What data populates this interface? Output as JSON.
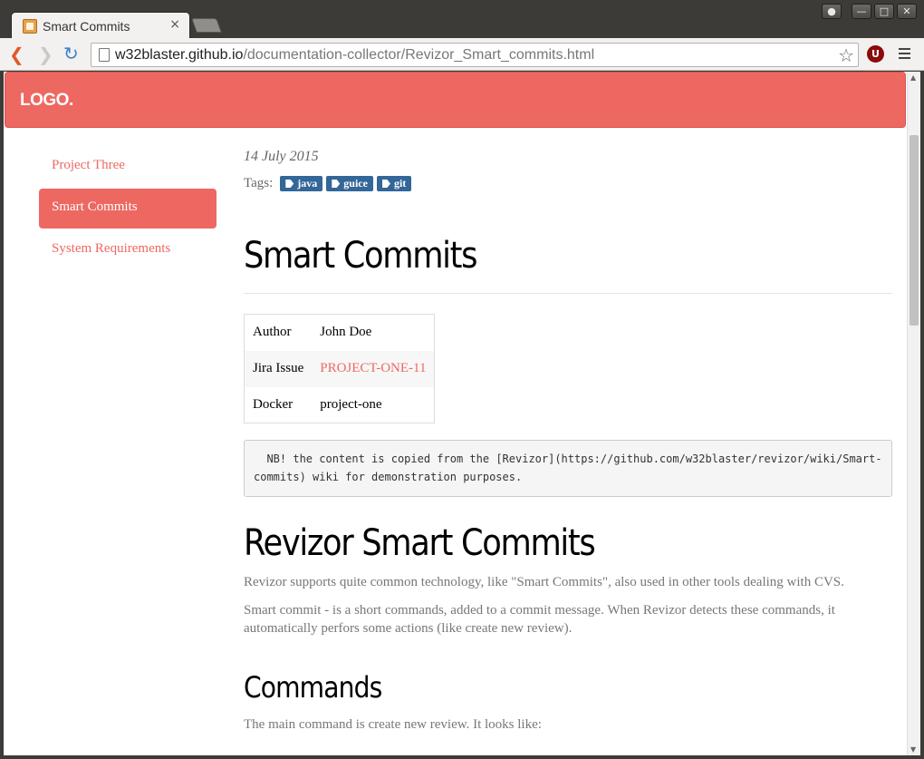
{
  "browser": {
    "tab_title": "Smart Commits",
    "tab_close": "×",
    "url_host": "w32blaster.github.io",
    "url_path": "/documentation-collector/Revizor_Smart_commits.html",
    "extension_label": "U"
  },
  "header": {
    "logo": "LOGO."
  },
  "sidebar": {
    "items": [
      {
        "label": "Project Three"
      },
      {
        "label": "Smart Commits"
      },
      {
        "label": "System Requirements"
      }
    ]
  },
  "article": {
    "date": "14 July 2015",
    "tags_label": "Tags:",
    "tags": [
      "java",
      "guice",
      "git"
    ],
    "title": "Smart Commits",
    "meta": [
      {
        "key": "Author",
        "value": "John Doe"
      },
      {
        "key": "Jira Issue",
        "value": "PROJECT-ONE-11"
      },
      {
        "key": "Docker",
        "value": "project-one"
      }
    ],
    "note": "  NB! the content is copied from the [Revizor](https://github.com/w32blaster/revizor/wiki/Smart-commits) wiki for demonstration purposes.",
    "section_title": "Revizor Smart Commits",
    "paragraphs": [
      "Revizor supports quite common technology, like \"Smart Commits\", also used in other tools dealing with CVS.",
      "Smart commit - is a short commands, added to a commit message. When Revizor detects these commands, it automatically perfors some actions (like create new review)."
    ],
    "subsection_title": "Commands",
    "cut_text": "The main command is create new review. It looks like:"
  },
  "colors": {
    "brand": "#ee6862",
    "tag": "#336699"
  }
}
